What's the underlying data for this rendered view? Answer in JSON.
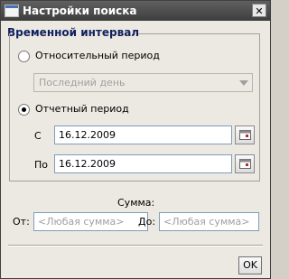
{
  "window": {
    "title": "Настройки поиска",
    "close_label": "✕"
  },
  "time_group": {
    "title": "Временной интервал",
    "relative": {
      "label": "Относительный период",
      "checked": false
    },
    "relative_combo": {
      "value": "Последний день"
    },
    "report": {
      "label": "Отчетный период",
      "checked": true
    },
    "from": {
      "label": "С",
      "value": "16.12.2009"
    },
    "to": {
      "label": "По",
      "value": "16.12.2009"
    }
  },
  "amount": {
    "title": "Сумма:",
    "from_label": "От:",
    "from_placeholder": "<Любая сумма>",
    "to_label": "До:",
    "to_placeholder": "<Любая сумма>"
  },
  "ok_label": "OK",
  "icons": {
    "calendar": "calendar-icon",
    "app": "app-window-icon"
  }
}
